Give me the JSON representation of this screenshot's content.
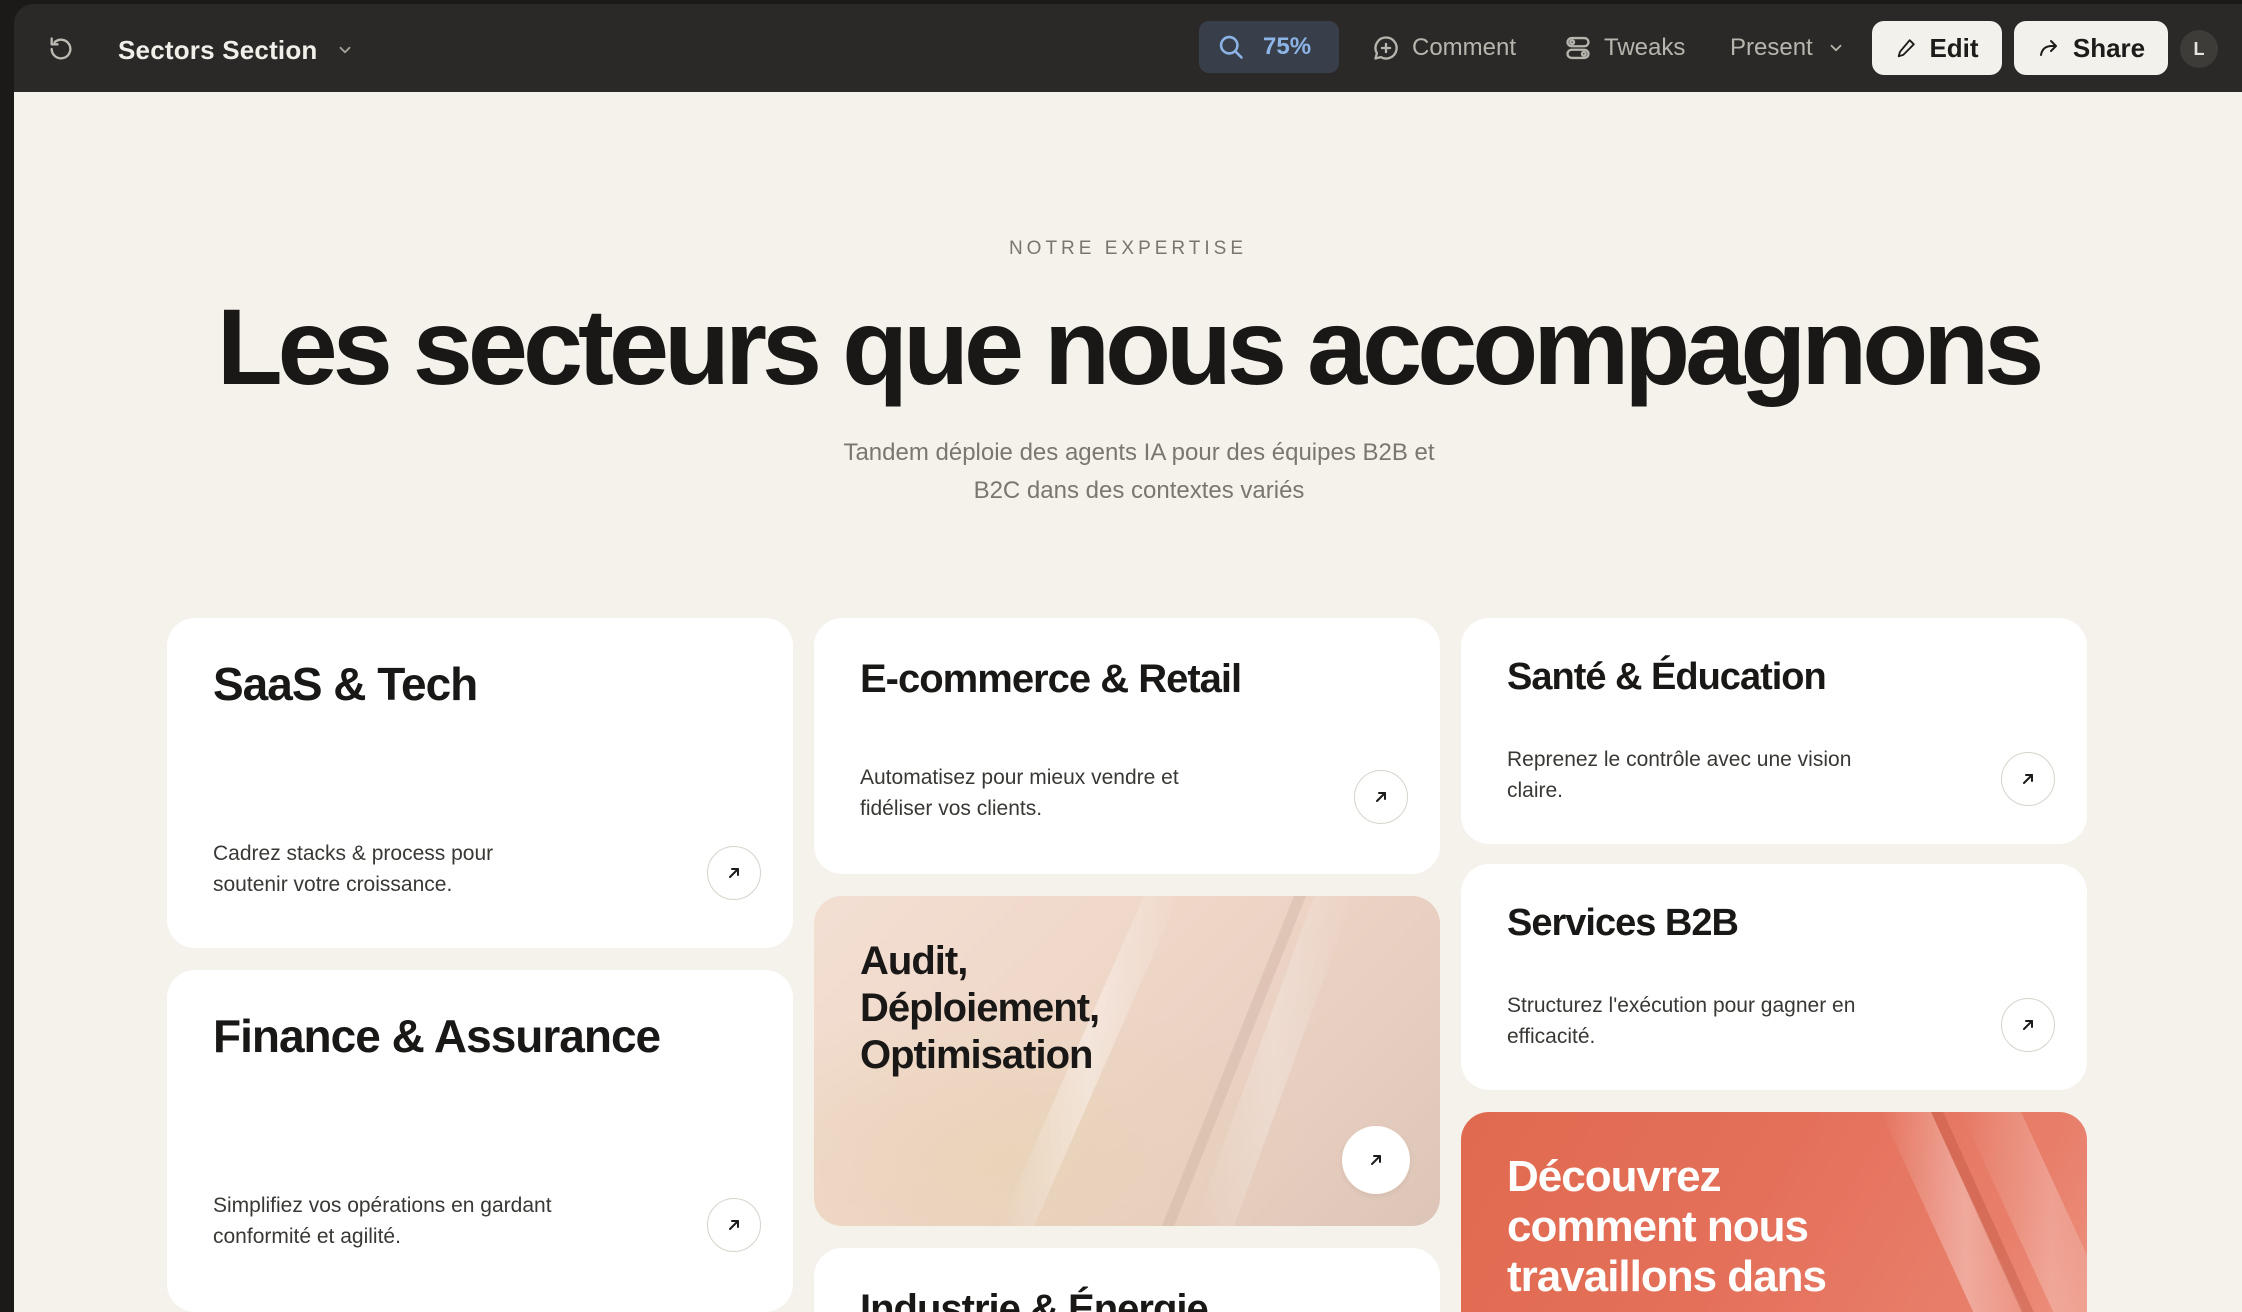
{
  "toolbar": {
    "doc_title": "Sectors Section",
    "zoom": "75%",
    "comment_label": "Comment",
    "tweaks_label": "Tweaks",
    "present_label": "Present",
    "edit_label": "Edit",
    "share_label": "Share",
    "avatar_initial": "L"
  },
  "section": {
    "eyebrow": "NOTRE EXPERTISE",
    "headline": "Les secteurs que nous accompagnons",
    "subhead_line1": "Tandem déploie des agents IA pour des équipes B2B et",
    "subhead_line2": "B2C dans des contextes variés"
  },
  "cards": {
    "saas": {
      "title": "SaaS & Tech",
      "desc_line1": "Cadrez stacks & process pour",
      "desc_line2": "soutenir votre croissance."
    },
    "ecommerce": {
      "title": "E-commerce & Retail",
      "desc_line1": "Automatisez pour mieux vendre et",
      "desc_line2": "fidéliser vos clients."
    },
    "sante": {
      "title": "Santé & Éducation",
      "desc_line1": "Reprenez le contrôle avec une vision",
      "desc_line2": "claire."
    },
    "finance": {
      "title": "Finance & Assurance",
      "desc_line1": "Simplifiez vos opérations en gardant",
      "desc_line2": "conformité et agilité."
    },
    "audit": {
      "title_line1": "Audit,",
      "title_line2": "Déploiement,",
      "title_line3": "Optimisation"
    },
    "services": {
      "title": "Services B2B",
      "desc_line1": "Structurez l'exécution pour gagner en",
      "desc_line2": "efficacité."
    },
    "industrie": {
      "title": "Industrie & Énergie"
    },
    "decouvrez": {
      "title_line1": "Découvrez",
      "title_line2": "comment nous",
      "title_line3": "travaillons dans"
    }
  },
  "icons": {
    "reload": "reload-icon",
    "chevron": "chevron-down-icon",
    "search": "search-icon",
    "comment": "comment-icon",
    "tweaks": "tweaks-icon",
    "edit": "pencil-icon",
    "share": "share-icon",
    "arrow": "arrow-up-right-icon"
  },
  "colors": {
    "toolbar_bg": "#2a2927",
    "canvas_bg": "#f5f1eb",
    "zoom_accent": "#8cb4e6",
    "coral": "#e4705a",
    "peach": "#efd7c8"
  }
}
